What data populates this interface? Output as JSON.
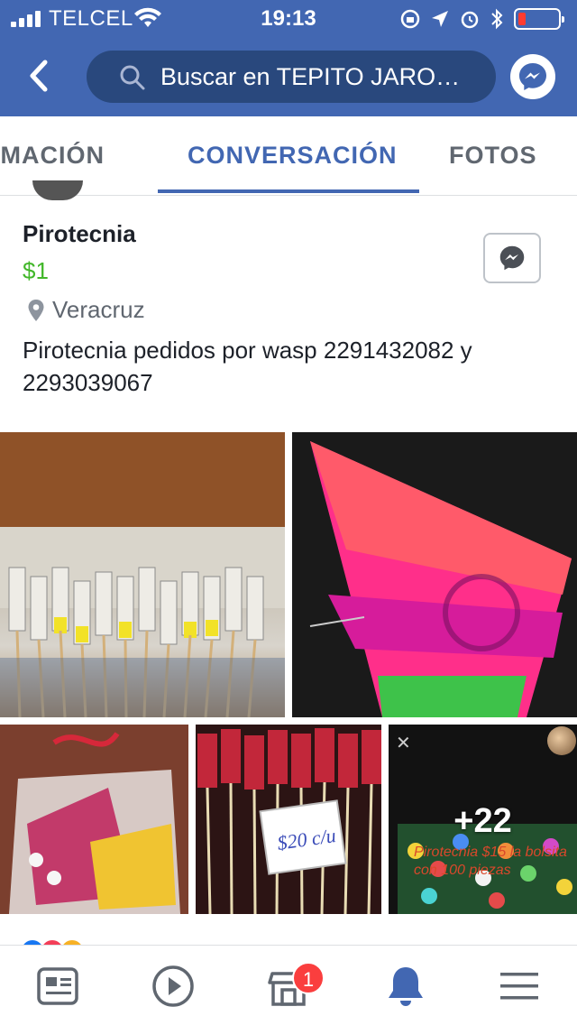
{
  "status_bar": {
    "carrier": "TELCEL",
    "time": "19:13",
    "battery_level_pct": 15
  },
  "header": {
    "search_text": "Buscar en TEPITO JARO…"
  },
  "tabs": [
    {
      "label": "RMACIÓN",
      "active": false
    },
    {
      "label": "CONVERSACIÓN",
      "active": true
    },
    {
      "label": "FOTOS",
      "active": false
    }
  ],
  "post": {
    "title": "Pirotecnia",
    "price": "$1",
    "location": "Veracruz",
    "description": "Pirotecnia pedidos por wasp 2291432082 y 2293039067"
  },
  "photos": {
    "more_count_label": "+22",
    "overlay_caption": "Pirotecnia $15 la bolsita con 100 piezas",
    "price_tag_text": "$20 c/u"
  },
  "bottom_nav": {
    "marketplace_badge": "1",
    "items": [
      "news-feed",
      "watch",
      "marketplace",
      "notifications",
      "menu"
    ]
  },
  "colors": {
    "header_blue": "#4267b2",
    "search_bg": "#29487d",
    "price_green": "#42b72a",
    "active_tab": "#4267b2",
    "badge_red": "#fa3e3e"
  }
}
